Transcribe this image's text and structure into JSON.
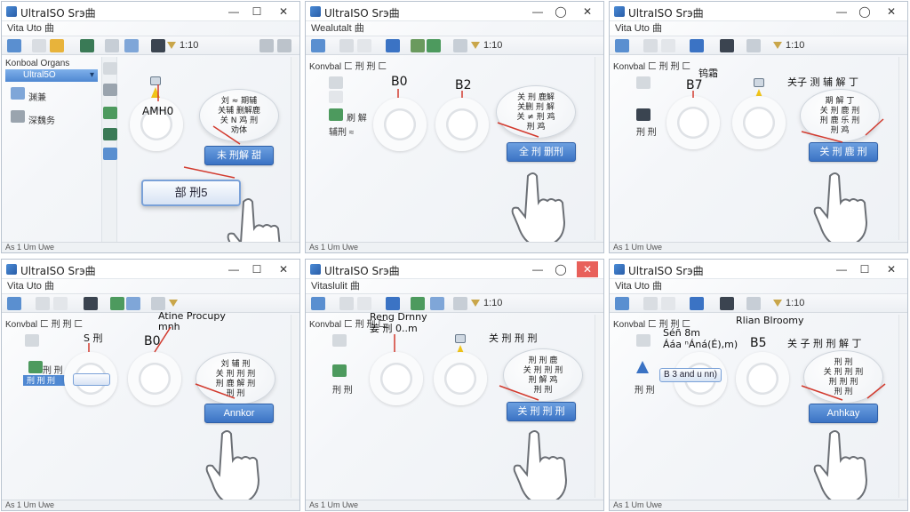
{
  "panels": [
    {
      "title": "UltraISO Srэ曲",
      "menu": "Vita Uto 曲",
      "zoom": "1:10",
      "status": "As 1 Um Uwe",
      "side": {
        "header": "Konboal Organs",
        "dropdown": "Ultral5O",
        "item1": "渊兼",
        "item2": "深魏务"
      },
      "center_label": "AMH0",
      "bubble": "刘 ≈ 期辅\n关辅 删解鹿\n关 N 鸡 刑\n劝体",
      "button": "未 刑解 甜",
      "big_button": "部 刑5"
    },
    {
      "title": "UltraISO Srэ曲",
      "menu": "Wealutalt 曲",
      "zoom": "1:10",
      "status": "As 1 Um Uwe",
      "side": {
        "item1": "刷 解",
        "item2": "辅刑 ≈"
      },
      "left_label": "B0",
      "right_label": "B2",
      "bubble": "关 刑 鹿解\n关删 刑 解\n关 ≠ 刑 鸡\n刑 鸡",
      "button": "全 刑 删刑"
    },
    {
      "title": "UltraISO Srэ曲",
      "menu": "Vita Uto 曲",
      "zoom": "1:10",
      "status": "As 1 Um Uwe",
      "side": {
        "item1": "刑 刑"
      },
      "top_label": "钨霜",
      "left_label": "B7",
      "right_label": "关子 测 辅 解 丁",
      "bubble": "期 解 丁\n关 刑 鹿 刑\n刑 鹿 乐 刑\n刑 鸡",
      "button": "关 刑 鹿 刑"
    },
    {
      "title": "UltraISO Srэ曲",
      "menu": "Vita Uto 曲",
      "zoom": "",
      "status": "As 1 Um Uwe",
      "side": {
        "item1": "刑 刑",
        "item2": "刑 刑 刑"
      },
      "left_label": "S 刑",
      "mid_label": "B0",
      "caption": "Atine Procupy\nmnh",
      "bubble": "刘 辅 刑\n关 刑 刑 刑\n刑 鹿 解 刑\n刑 刑",
      "button": "Annkor"
    },
    {
      "title": "UltraISO Srэ曲",
      "menu": "Vitaslulit 曲",
      "zoom": "1:10",
      "status": "As 1 Um Uwe",
      "side": {
        "item1": "刑 刑"
      },
      "caption": "Reng Drnny\n姜 刑 0..m",
      "right_label": "关 刑 刑 刑",
      "bubble": "刑 刑 鹿\n关 刑 刑 刑\n刑 解 鸡\n刑 刑",
      "button": "关 刑 刑 刑"
    },
    {
      "title": "UltraISO Srэ曲",
      "menu": "Vita Uto 曲",
      "zoom": "1:10",
      "status": "As 1 Um Uwe",
      "side": {
        "item1": "刑 刑"
      },
      "caption": "Séñ 8m\nÁáa ⁿÁná(É),m)",
      "top_right": "Rlian Blroomy",
      "field": "B 3 and u nn)",
      "mid_label": "B5",
      "right_label": "关 子 刑 刑 解 丁",
      "bubble": "刑 刑\n关 刑 刑 刑\n刑 刑 刑\n刑 刑",
      "button": "Anhkay"
    }
  ],
  "colors": {
    "accent": "#3b73c4",
    "arrow": "#d23a2e",
    "titlebar": "#ffffff"
  }
}
